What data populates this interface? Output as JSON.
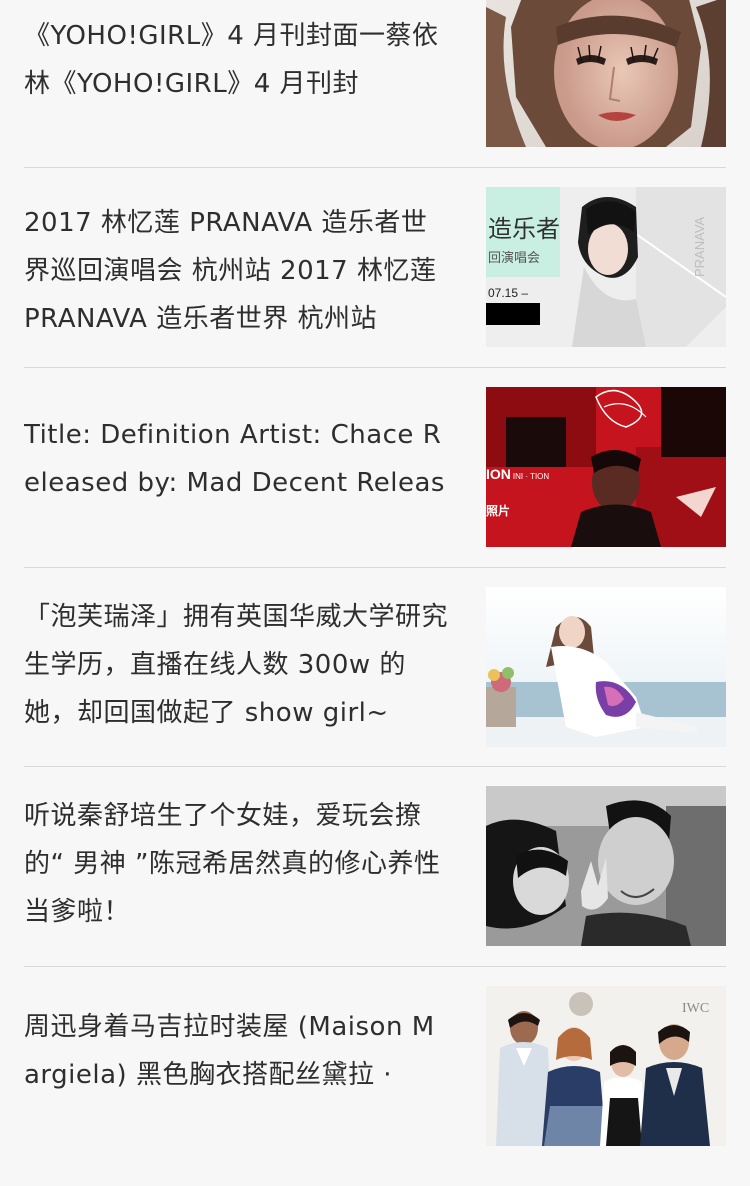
{
  "articles": [
    {
      "title": "《YOHO!GIRL》4 月刊封面一蔡依林《YOHO!GIRL》4 月刊封",
      "thumb_alt": "portrait-photo"
    },
    {
      "title": "2017 林忆莲 PRANAVA 造乐者世界巡回演唱会 杭州站 2017 林忆莲 PRANAVA 造乐者世界 杭州站",
      "thumb_alt": "concert-poster",
      "poster_text": {
        "left": "造乐者",
        "left_sub": "回演唱会",
        "date": "07.15 –",
        "vertical": "PRANAVA"
      }
    },
    {
      "title": "Title: Definition Artist: Chace Released by: Mad Decent Release",
      "thumb_alt": "album-art",
      "poster_text": {
        "brand": "ION",
        "small": "· INI · TION",
        "tag": "照片"
      }
    },
    {
      "title": "「泡芙瑞泽」拥有英国华威大学研究生学历，直播在线人数 300w 的她，却回国做起了 show girl~",
      "thumb_alt": "seaside-photo"
    },
    {
      "title": "听说秦舒培生了个女娃，爱玩会撩的“ 男神 ”陈冠希居然真的修心养性当爹啦！",
      "thumb_alt": "couple-photo"
    },
    {
      "title": "周迅身着马吉拉时装屋 (Maison Margiela) 黑色胸衣搭配丝黛拉 ·",
      "thumb_alt": "event-photo",
      "poster_text": {
        "brand": "IWC"
      }
    }
  ]
}
